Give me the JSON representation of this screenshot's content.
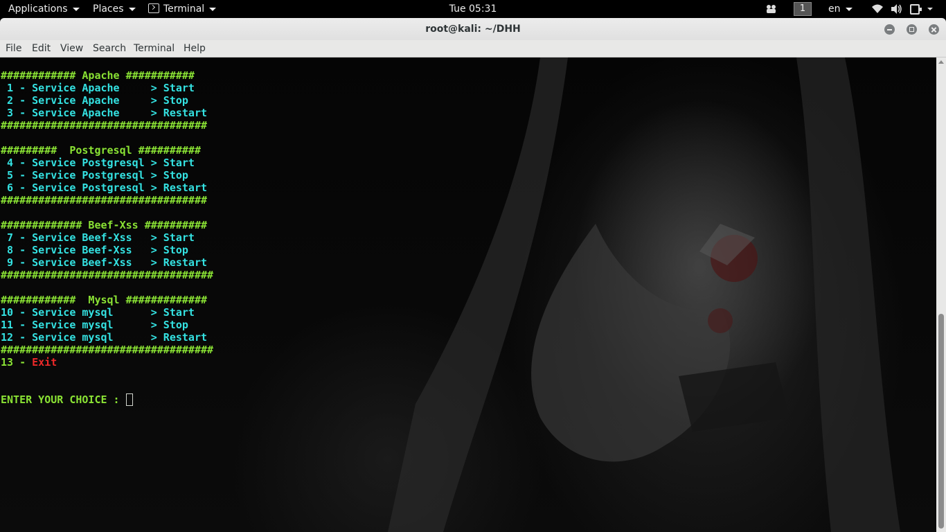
{
  "topbar": {
    "applications": "Applications",
    "places": "Places",
    "terminal": "Terminal",
    "clock": "Tue 05:31",
    "workspace": "1",
    "lang": "en",
    "icons": [
      "bluetooth-icon",
      "wifi-icon",
      "volume-icon",
      "power-icon"
    ]
  },
  "window": {
    "title": "root@kali: ~/DHH",
    "menu": {
      "file": "File",
      "edit": "Edit",
      "view": "View",
      "search": "Search",
      "terminal": "Terminal",
      "help": "Help"
    }
  },
  "terminal": {
    "colors": {
      "green": "#8ae234",
      "cyan": "#34e2e2",
      "red": "#ef2929"
    },
    "apache": {
      "header": "############ Apache ###########",
      "l1": " 1 - Service Apache     > Start",
      "l2": " 2 - Service Apache     > Stop",
      "l3": " 3 - Service Apache     > Restart",
      "footer": "#################################"
    },
    "postgres": {
      "header": "#########  Postgresql ##########",
      "l1": " 4 - Service Postgresql > Start",
      "l2": " 5 - Service Postgresql > Stop",
      "l3": " 6 - Service Postgresql > Restart",
      "footer": "#################################"
    },
    "beef": {
      "header": "############# Beef-Xss ##########",
      "l1": " 7 - Service Beef-Xss   > Start",
      "l2": " 8 - Service Beef-Xss   > Stop",
      "l3": " 9 - Service Beef-Xss   > Restart",
      "footer": "##################################"
    },
    "mysql": {
      "header": "############  Mysql #############",
      "l1": "10 - Service mysql      > Start",
      "l2": "11 - Service mysql      > Stop",
      "l3": "12 - Service mysql      > Restart",
      "footer": "##################################"
    },
    "exit_num": "13 - ",
    "exit_label": "Exit",
    "prompt": "ENTER YOUR CHOICE : "
  }
}
